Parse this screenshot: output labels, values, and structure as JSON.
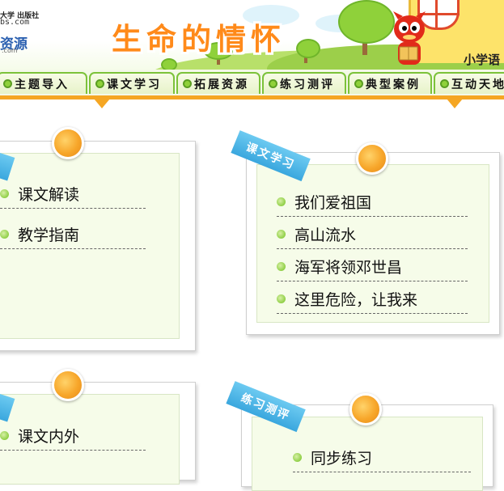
{
  "header": {
    "logo_top": "大学 出版社",
    "logo_domain": "bs.com",
    "logo_main": "资源",
    "logo_sub": ".com",
    "site_title": "生命的情怀",
    "corner_label": "小学语"
  },
  "nav": {
    "tabs": [
      {
        "label": "主题导入"
      },
      {
        "label": "课文学习"
      },
      {
        "label": "拓展资源"
      },
      {
        "label": "练习测评"
      },
      {
        "label": "典型案例"
      },
      {
        "label": "互动天地"
      }
    ]
  },
  "panels": {
    "left_top": {
      "items": [
        {
          "label": "课文解读"
        },
        {
          "label": "教学指南"
        }
      ]
    },
    "right_top": {
      "ribbon": "课文学习",
      "items": [
        {
          "label": "我们爱祖国"
        },
        {
          "label": "高山流水"
        },
        {
          "label": "海军将领邓世昌"
        },
        {
          "label": "这里危险，让我来"
        }
      ]
    },
    "left_bottom": {
      "items": [
        {
          "label": "课文内外"
        }
      ]
    },
    "right_bottom": {
      "ribbon": "练习测评",
      "items": [
        {
          "label": "同步练习"
        }
      ]
    }
  },
  "colors": {
    "title_orange": "#ff8a1a",
    "nav_green": "#7cc23a",
    "accent_orange": "#f5a623",
    "ribbon_blue": "#3aa7de",
    "panel_bg": "#f6fce9"
  }
}
